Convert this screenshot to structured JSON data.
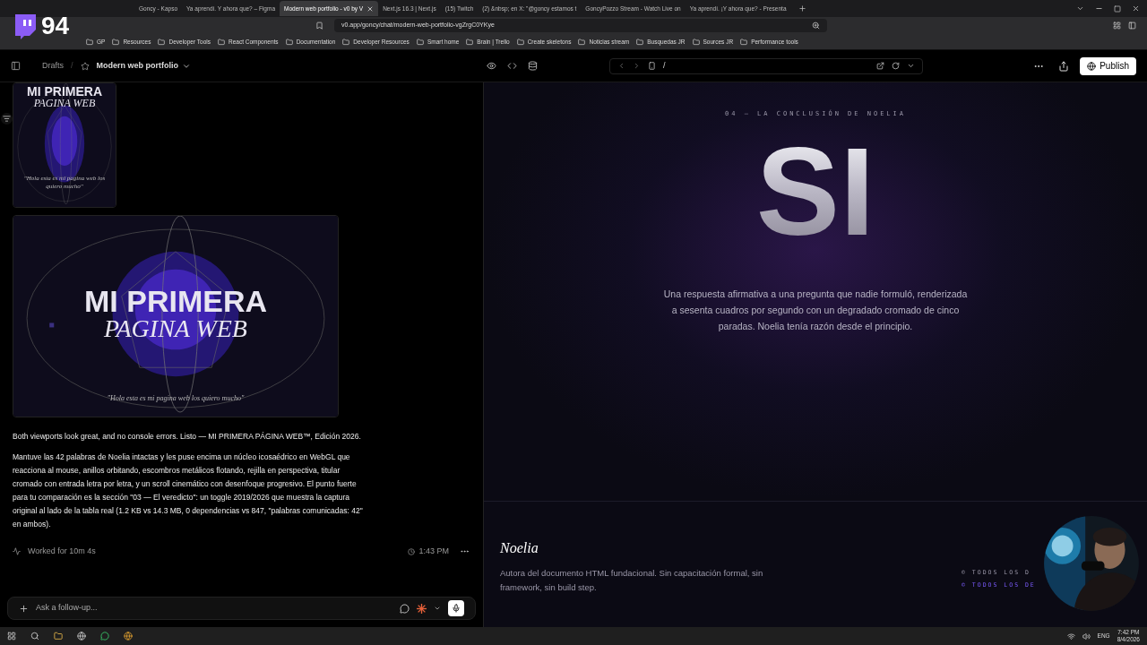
{
  "browser": {
    "tabs": [
      {
        "title": "Goncy - Kapso",
        "selected": false
      },
      {
        "title": "Ya aprendí. Y ahora que? – Figma",
        "selected": false
      },
      {
        "title": "Modern web portfolio - v0 by V",
        "selected": true
      },
      {
        "title": "Next.js 16.3 | Next.js",
        "selected": false
      },
      {
        "title": "(15) Twitch",
        "selected": false
      },
      {
        "title": "(2) &nbsp; en X: \"@goncy estamos t",
        "selected": false
      },
      {
        "title": "GoncyPozzo Stream - Watch Live on",
        "selected": false
      },
      {
        "title": "Ya aprendí. ¡Y ahora que? - Presenta",
        "selected": false
      }
    ],
    "url": "v0.app/goncy/chat/modern-web-portfolio-vgZrgC0YKye",
    "bookmarks": [
      "GP",
      "Resources",
      "Developer Tools",
      "React Components",
      "Documentation",
      "Developer Resources",
      "Smart home",
      "Brain | Trello",
      "Create skeletons",
      "Noticias stream",
      "Busquedas JR",
      "Sources JR",
      "Performance tools"
    ]
  },
  "stream_overlay": {
    "count": "94"
  },
  "header": {
    "breadcrumb": "Drafts",
    "separator": "/",
    "project": "Modern web portfolio",
    "preview_path": "/",
    "publish": "Publish"
  },
  "chat": {
    "thumbnails": [
      {
        "title": "MI PRIMERA",
        "subtitle": "PAGINA WEB",
        "quote": "\"Hola esta es mi pagina web los quiero mucho\""
      },
      {
        "title": "MI PRIMERA",
        "subtitle": "PAGINA WEB",
        "quote": "\"Hola esta es mi pagina web los quiero mucho\""
      }
    ],
    "messages": [
      "Both viewports look great, and no console errors. Listo — MI PRIMERA PÁGINA WEB™, Edición 2026.",
      "Mantuve las 42 palabras de Noelia intactas y les puse encima un núcleo icosaédrico en WebGL que reacciona al mouse, anillos orbitando, escombros metálicos flotando, rejilla en perspectiva, titular cromado con entrada letra por letra, y un scroll cinemático con desenfoque progresivo. El punto fuerte para tu comparación es la sección \"03 — El veredicto\": un toggle 2019/2026 que muestra la captura original al lado de la tabla real (1.2 KB vs 14.3 MB, 0 dependencias vs 847, \"palabras comunicadas: 42\" en ambos)."
    ],
    "worked": "Worked for 10m 4s",
    "time": "1:43 PM",
    "input_placeholder": "Ask a follow-up..."
  },
  "preview": {
    "eyebrow": "04 — LA CONCLUSIÓN DE NOELIA",
    "headline": "SI",
    "body": "Una respuesta afirmativa a una pregunta que nadie formuló, renderizada a sesenta cuadros por segundo con un degradado cromado de cinco paradas. Noelia tenía razón desde el principio.",
    "author": "Noelia",
    "author_bio": "Autora del documento HTML fundacional. Sin capacitación formal, sin framework, sin build step.",
    "footer_lines": [
      {
        "text": "© TODOS LOS D",
        "highlighted": false
      },
      {
        "text": "© TODOS LOS DE",
        "highlighted": true
      }
    ]
  },
  "taskbar": {
    "language": "ENG",
    "time": "7:42 PM",
    "date": "8/4/2026"
  }
}
